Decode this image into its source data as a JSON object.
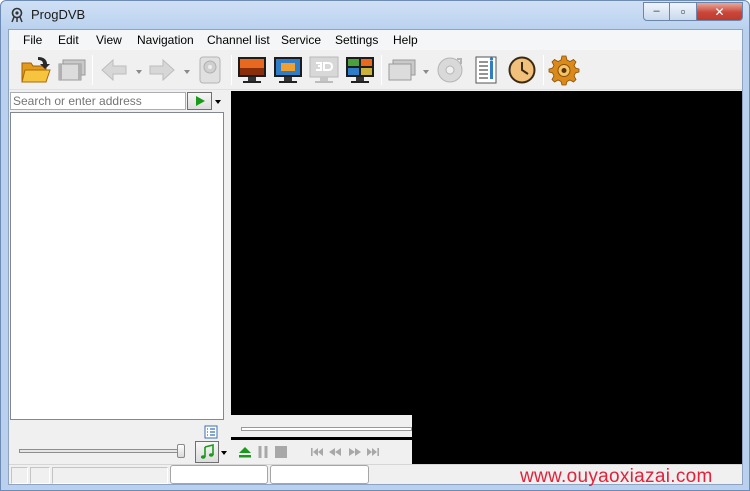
{
  "window": {
    "title": "ProgDVB",
    "minimize_glyph": "–",
    "maximize_glyph": "▫",
    "close_glyph": "✕"
  },
  "menu": [
    "File",
    "Edit",
    "View",
    "Navigation",
    "Channel list",
    "Service",
    "Settings",
    "Help"
  ],
  "toolbar": {
    "icons": [
      "open-folder-icon",
      "channel-list-icon",
      "back-icon",
      "forward-icon",
      "recorder-icon",
      "tv-screen-icon",
      "monitor-icon",
      "3d-icon",
      "mosaic-icon",
      "multi-channel-icon",
      "disc-icon",
      "epg-info-icon",
      "scheduler-clock-icon",
      "settings-gear-icon"
    ]
  },
  "search": {
    "placeholder": "Search or enter address"
  },
  "colors": {
    "accent_green": "#1a9a1a",
    "video_background": "#000000",
    "watermark": "#e2223a"
  },
  "watermark": "www.ouyaoxiazai.com"
}
